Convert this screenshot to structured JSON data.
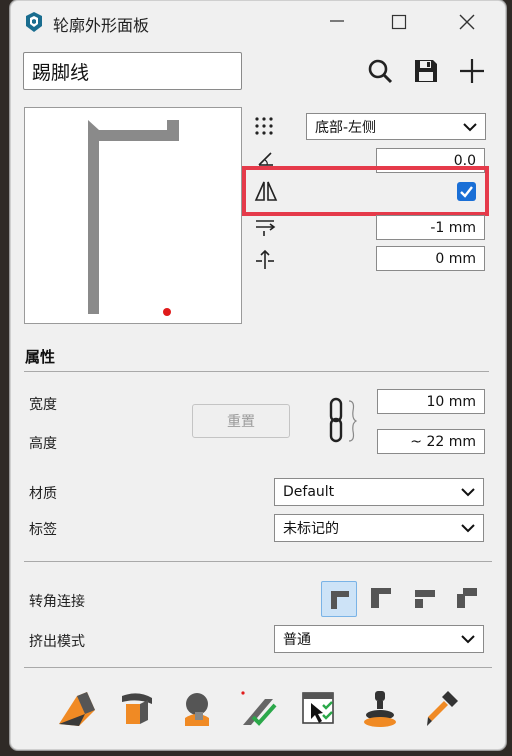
{
  "window": {
    "title": "轮廓外形面板"
  },
  "toolbar": {
    "name_value": "踢脚线"
  },
  "placement": {
    "anchor_selected": "底部-左侧",
    "angle_value": "0.0",
    "mirror_checked": true,
    "offset_h_value": "-1 mm",
    "offset_v_value": "0 mm"
  },
  "properties": {
    "section_title": "属性",
    "width_label": "宽度",
    "height_label": "高度",
    "reset_label": "重置",
    "width_value": "10 mm",
    "height_value": "~ 22 mm",
    "material_label": "材质",
    "material_value": "Default",
    "tag_label": "标签",
    "tag_value": "未标记的"
  },
  "join": {
    "corner_label": "转角连接",
    "extrude_label": "挤出模式",
    "extrude_value": "普通"
  },
  "colors": {
    "accent": "#e53a4a",
    "check": "#1a6fd6",
    "orange": "#f08a24",
    "green": "#2ba84a"
  }
}
